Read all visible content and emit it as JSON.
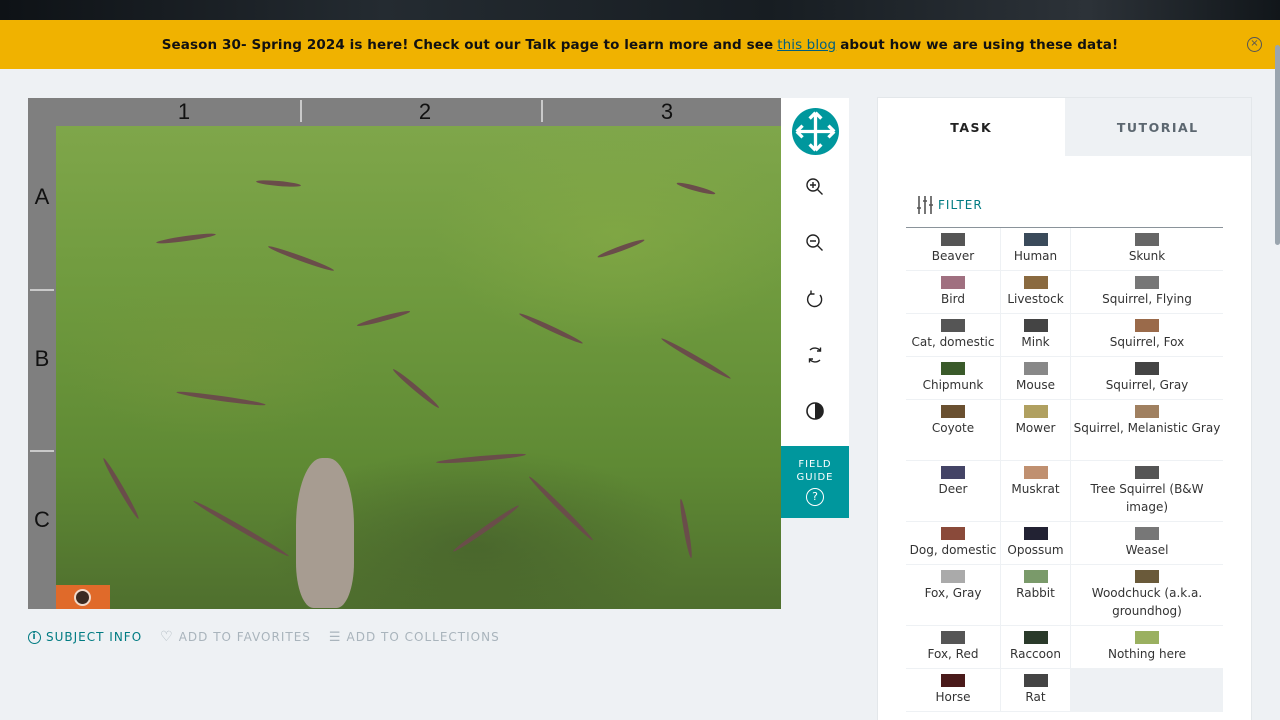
{
  "banner": {
    "text_before": "Season 30- Spring 2024 is here! Check out our Talk page to learn more and see",
    "link_text": "this blog",
    "text_after": "about how we are using these data!",
    "close_icon": "×"
  },
  "viewer": {
    "columns": [
      "1",
      "2",
      "3"
    ],
    "rows": [
      "A",
      "B",
      "C"
    ]
  },
  "toolbar": {
    "move_icon": "move-arrows-icon",
    "zoom_in_icon": "zoom-in-icon",
    "zoom_out_icon": "zoom-out-icon",
    "rotate_icon": "rotate-icon",
    "reset_icon": "reset-icon",
    "invert_icon": "invert-icon",
    "field_guide_line1": "FIELD",
    "field_guide_line2": "GUIDE",
    "field_guide_q": "?"
  },
  "meta": {
    "subject_info": "SUBJECT INFO",
    "add_favorites": "ADD TO FAVORITES",
    "add_collections": "ADD TO COLLECTIONS"
  },
  "panel": {
    "tab_task": "TASK",
    "tab_tutorial": "TUTORIAL",
    "filter_label": "FILTER",
    "choices": [
      [
        "Beaver",
        "Human",
        "Skunk"
      ],
      [
        "Bird",
        "Livestock",
        "Squirrel, Flying"
      ],
      [
        "Cat, domestic",
        "Mink",
        "Squirrel, Fox"
      ],
      [
        "Chipmunk",
        "Mouse",
        "Squirrel, Gray"
      ],
      [
        "Coyote",
        "Mower",
        "Squirrel, Melanistic Gray"
      ],
      [
        "Deer",
        "Muskrat",
        "Tree Squirrel (B&W image)"
      ],
      [
        "Dog, domestic",
        "Opossum",
        "Weasel"
      ],
      [
        "Fox, Gray",
        "Rabbit",
        "Woodchuck (a.k.a. groundhog)"
      ],
      [
        "Fox, Red",
        "Raccoon",
        "Nothing here"
      ],
      [
        "Horse",
        "Rat",
        ""
      ]
    ]
  },
  "colors": {
    "banner": "#f0b200",
    "accent": "#00979d",
    "background": "#eef1f4"
  }
}
